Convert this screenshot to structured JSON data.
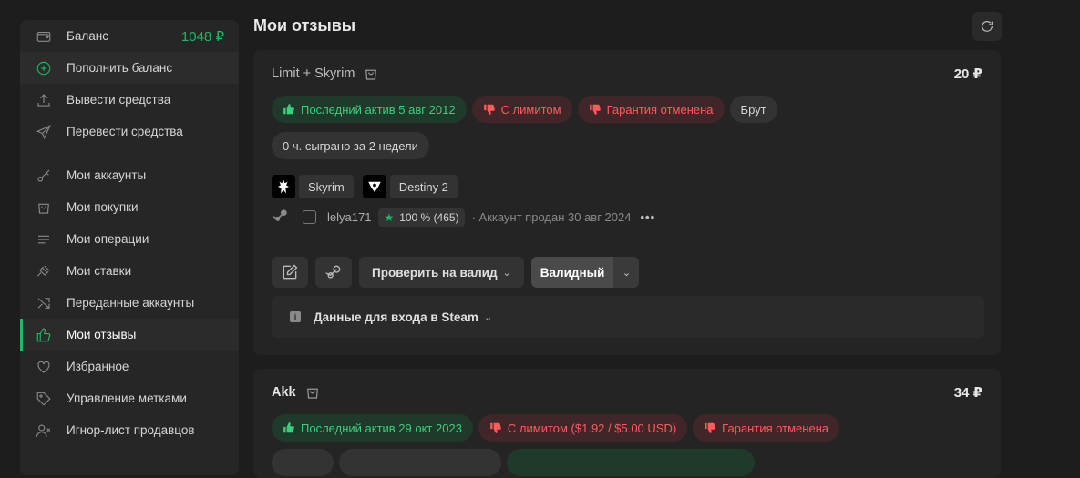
{
  "sidebar": {
    "balance_label": "Баланс",
    "balance_amount": "1048 ₽",
    "items": [
      {
        "label": "Пополнить баланс",
        "icon": "plus-circle-icon"
      },
      {
        "label": "Вывести средства",
        "icon": "upload-icon"
      },
      {
        "label": "Перевести средства",
        "icon": "send-icon"
      },
      {
        "label": "Мои аккаунты",
        "icon": "key-icon"
      },
      {
        "label": "Мои покупки",
        "icon": "bag-icon"
      },
      {
        "label": "Мои операции",
        "icon": "list-icon"
      },
      {
        "label": "Мои ставки",
        "icon": "gavel-icon"
      },
      {
        "label": "Переданные аккаунты",
        "icon": "shuffle-icon"
      },
      {
        "label": "Мои отзывы",
        "icon": "thumbs-up-icon"
      },
      {
        "label": "Избранное",
        "icon": "heart-icon"
      },
      {
        "label": "Управление метками",
        "icon": "tag-icon"
      },
      {
        "label": "Игнор-лист продавцов",
        "icon": "user-x-icon"
      }
    ]
  },
  "page": {
    "title": "Мои отзывы"
  },
  "card1": {
    "title": "Limit + Skyrim",
    "price": "20 ₽",
    "tags_row1": [
      {
        "text": "Последний актив 5 авг 2012",
        "kind": "green"
      },
      {
        "text": "С лимитом",
        "kind": "red"
      },
      {
        "text": "Гарантия отменена",
        "kind": "red"
      },
      {
        "text": "Брут",
        "kind": "neutral"
      }
    ],
    "tags_row2": [
      {
        "text": "0 ч. сыграно за 2 недели",
        "kind": "neutral"
      }
    ],
    "games": [
      {
        "name": "Skyrim"
      },
      {
        "name": "Destiny 2"
      }
    ],
    "seller": "lelya171",
    "rating": "100 % (465)",
    "sold": "· Аккаунт продан 30 авг 2024",
    "more": "•••",
    "check_label": "Проверить на валид",
    "valid_label": "Валидный",
    "login_label": "Данные для входа в Steam"
  },
  "card2": {
    "title": "Akk",
    "price": "34 ₽",
    "tags_row1": [
      {
        "text": "Последний актив 29 окт 2023",
        "kind": "green"
      },
      {
        "text": "С лимитом ($1.92 / $5.00 USD)",
        "kind": "red"
      },
      {
        "text": "Гарантия отменена",
        "kind": "red"
      }
    ]
  }
}
